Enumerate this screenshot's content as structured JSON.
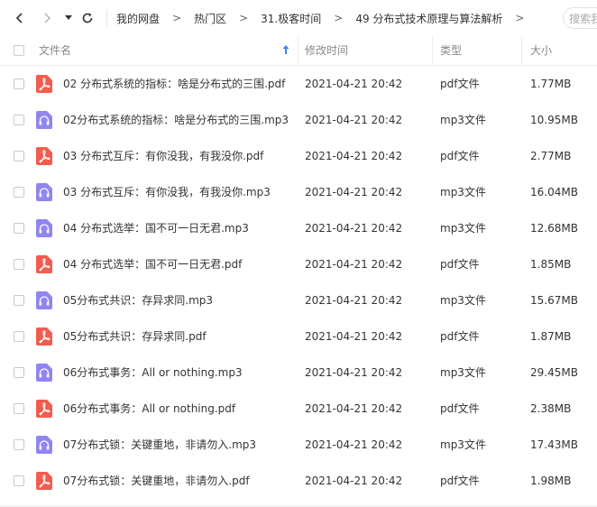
{
  "colors": {
    "pdf": "#f25c4f",
    "mp3": "#8f86f2",
    "accent": "#3b82f6"
  },
  "toolbar": {
    "back_icon": "chevron-left-icon",
    "forward_icon": "chevron-right-icon",
    "dropdown_icon": "caret-down-icon",
    "refresh_icon": "refresh-icon",
    "breadcrumb": [
      "我的网盘",
      "热门区",
      "31.极客时间",
      "49 分布式技术原理与算法解析"
    ],
    "breadcrumb_separator": ">",
    "search_placeholder": "搜索我"
  },
  "columns": {
    "name": "文件名",
    "modified": "修改时间",
    "type": "类型",
    "size": "大小"
  },
  "files": [
    {
      "name": "02  分布式系统的指标：啥是分布式的三围.pdf",
      "modified": "2021-04-21 20:42",
      "type": "pdf文件",
      "size": "1.77MB",
      "kind": "pdf"
    },
    {
      "name": "02分布式系统的指标：啥是分布式的三围.mp3",
      "modified": "2021-04-21 20:42",
      "type": "mp3文件",
      "size": "10.95MB",
      "kind": "mp3"
    },
    {
      "name": "03  分布式互斥：有你没我，有我没你.pdf",
      "modified": "2021-04-21 20:42",
      "type": "pdf文件",
      "size": "2.77MB",
      "kind": "pdf"
    },
    {
      "name": "03 分布式互斥：有你没我，有我没你.mp3",
      "modified": "2021-04-21 20:42",
      "type": "mp3文件",
      "size": "16.04MB",
      "kind": "mp3"
    },
    {
      "name": "04 分布式选举：国不可一日无君.mp3",
      "modified": "2021-04-21 20:42",
      "type": "mp3文件",
      "size": "12.68MB",
      "kind": "mp3"
    },
    {
      "name": "04 分布式选举：国不可一日无君.pdf",
      "modified": "2021-04-21 20:42",
      "type": "pdf文件",
      "size": "1.85MB",
      "kind": "pdf"
    },
    {
      "name": "05分布式共识：存异求同.mp3",
      "modified": "2021-04-21 20:42",
      "type": "mp3文件",
      "size": "15.67MB",
      "kind": "mp3"
    },
    {
      "name": "05分布式共识：存异求同.pdf",
      "modified": "2021-04-21 20:42",
      "type": "pdf文件",
      "size": "1.87MB",
      "kind": "pdf"
    },
    {
      "name": "06分布式事务：All or nothing.mp3",
      "modified": "2021-04-21 20:42",
      "type": "mp3文件",
      "size": "29.45MB",
      "kind": "mp3"
    },
    {
      "name": "06分布式事务：All or nothing.pdf",
      "modified": "2021-04-21 20:42",
      "type": "pdf文件",
      "size": "2.38MB",
      "kind": "pdf"
    },
    {
      "name": "07分布式锁：关键重地，非请勿入.mp3",
      "modified": "2021-04-21 20:42",
      "type": "mp3文件",
      "size": "17.43MB",
      "kind": "mp3"
    },
    {
      "name": "07分布式锁：关键重地，非请勿入.pdf",
      "modified": "2021-04-21 20:42",
      "type": "pdf文件",
      "size": "1.98MB",
      "kind": "pdf"
    }
  ]
}
